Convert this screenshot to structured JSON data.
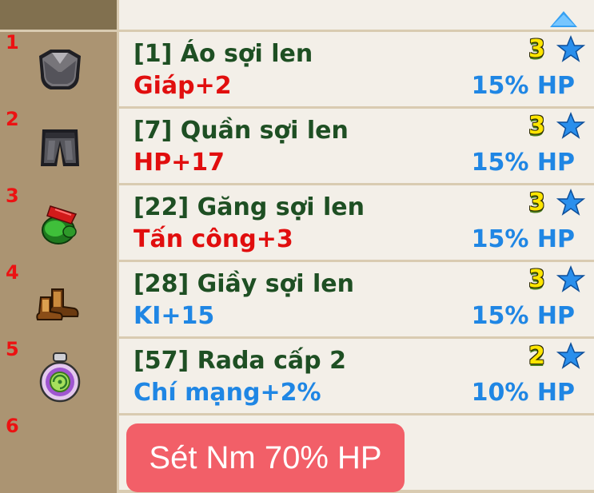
{
  "equipment": {
    "items": [
      {
        "slot": "1",
        "icon": "shirt-icon",
        "name": "[1] Áo sợi len",
        "bonus": "Giáp+2",
        "bonus_color": "red",
        "level": "3",
        "percent": "15% HP"
      },
      {
        "slot": "2",
        "icon": "pants-icon",
        "name": "[7] Quần sợi len",
        "bonus": "HP+17",
        "bonus_color": "red",
        "level": "3",
        "percent": "15% HP"
      },
      {
        "slot": "3",
        "icon": "gloves-icon",
        "name": "[22] Găng sợi len",
        "bonus": "Tấn công+3",
        "bonus_color": "red",
        "level": "3",
        "percent": "15% HP"
      },
      {
        "slot": "4",
        "icon": "boots-icon",
        "name": "[28] Giầy sợi len",
        "bonus": "KI+15",
        "bonus_color": "blue",
        "level": "3",
        "percent": "15% HP"
      },
      {
        "slot": "5",
        "icon": "radar-icon",
        "name": "[57] Rada cấp 2",
        "bonus": "Chí mạng+2%",
        "bonus_color": "blue",
        "level": "2",
        "percent": "10% HP"
      }
    ],
    "empty_slot": "6"
  },
  "caption": "Sét Nm 70% HP",
  "colors": {
    "name": "#1e4f23",
    "bonus_red": "#e10e0e",
    "bonus_blue": "#1f86e4",
    "slot_bg": "#ab9472",
    "panel_bg": "#f3efe8",
    "caption_bg": "#f25f68"
  }
}
